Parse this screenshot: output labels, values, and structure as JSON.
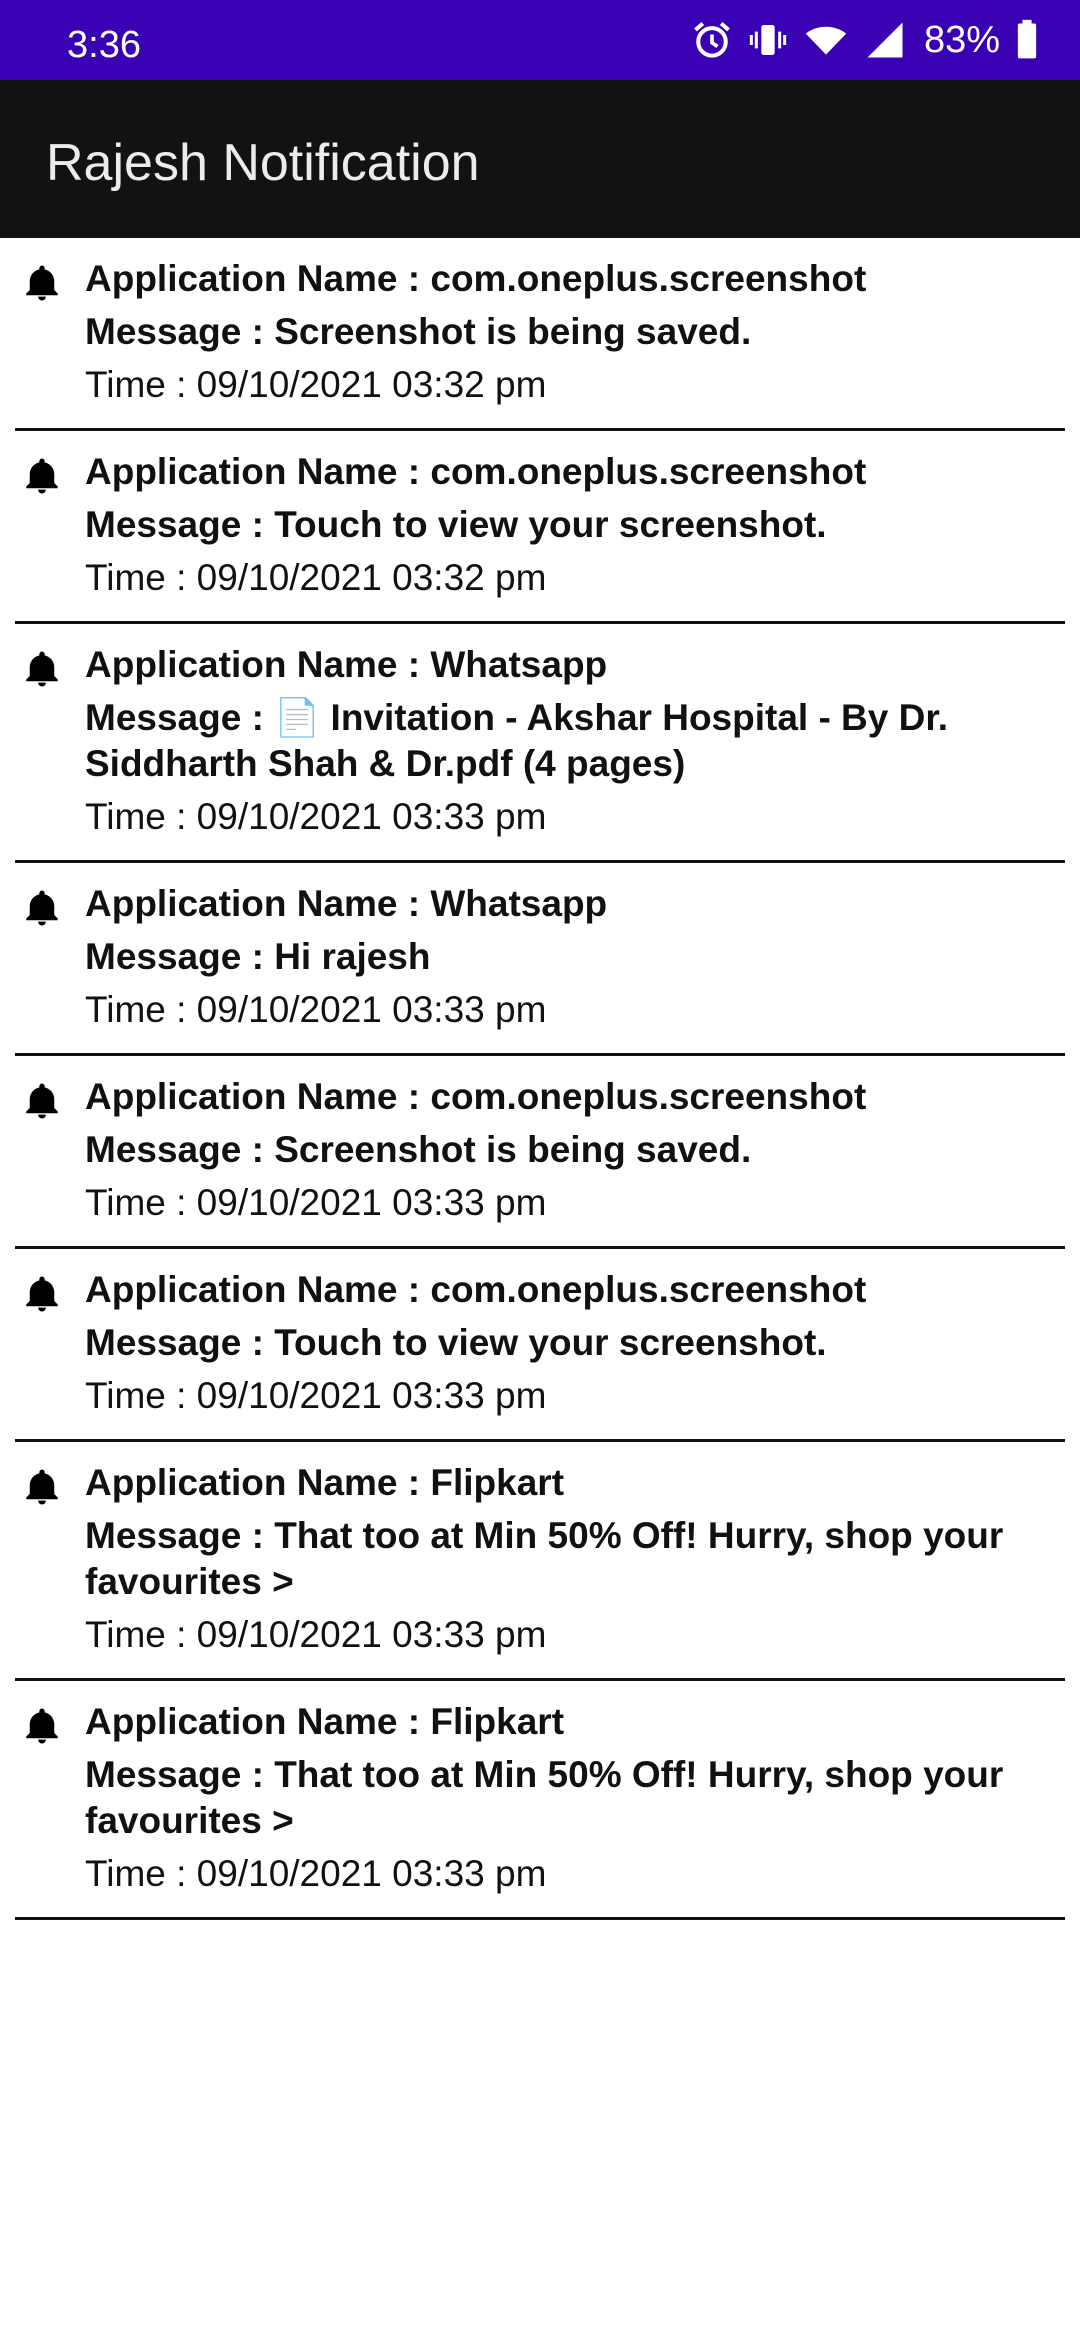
{
  "status_bar": {
    "time": "3:36",
    "battery": "83%",
    "icons": [
      "alarm-icon",
      "vibrate-icon",
      "wifi-icon",
      "signal-icon",
      "battery-icon"
    ]
  },
  "app_bar": {
    "title": "Rajesh Notification"
  },
  "colors": {
    "status_bar": "#3a00b3",
    "app_bar": "#121212",
    "divider": "#111111"
  },
  "notifications": [
    {
      "app": "Application Name : com.oneplus.screenshot",
      "message": "Message : Screenshot is being saved.",
      "time": "Time : 09/10/2021 03:32 pm"
    },
    {
      "app": "Application Name : com.oneplus.screenshot",
      "message": "Message : Touch to view your screenshot.",
      "time": "Time : 09/10/2021 03:32 pm"
    },
    {
      "app": "Application Name : Whatsapp",
      "message": "Message : 📄 Invitation - Akshar Hospital - By Dr. Siddharth Shah & Dr.pdf (4 pages)",
      "time": "Time : 09/10/2021 03:33 pm"
    },
    {
      "app": "Application Name : Whatsapp",
      "message": "Message : Hi rajesh",
      "time": "Time : 09/10/2021 03:33 pm"
    },
    {
      "app": "Application Name : com.oneplus.screenshot",
      "message": "Message : Screenshot is being saved.",
      "time": "Time : 09/10/2021 03:33 pm"
    },
    {
      "app": "Application Name : com.oneplus.screenshot",
      "message": "Message : Touch to view your screenshot.",
      "time": "Time : 09/10/2021 03:33 pm"
    },
    {
      "app": "Application Name : Flipkart",
      "message": "Message : That too at Min 50% Off! Hurry, shop your favourites >",
      "time": "Time : 09/10/2021 03:33 pm"
    },
    {
      "app": "Application Name : Flipkart",
      "message": "Message : That too at Min 50% Off! Hurry, shop your favourites >",
      "time": "Time : 09/10/2021 03:33 pm"
    }
  ]
}
